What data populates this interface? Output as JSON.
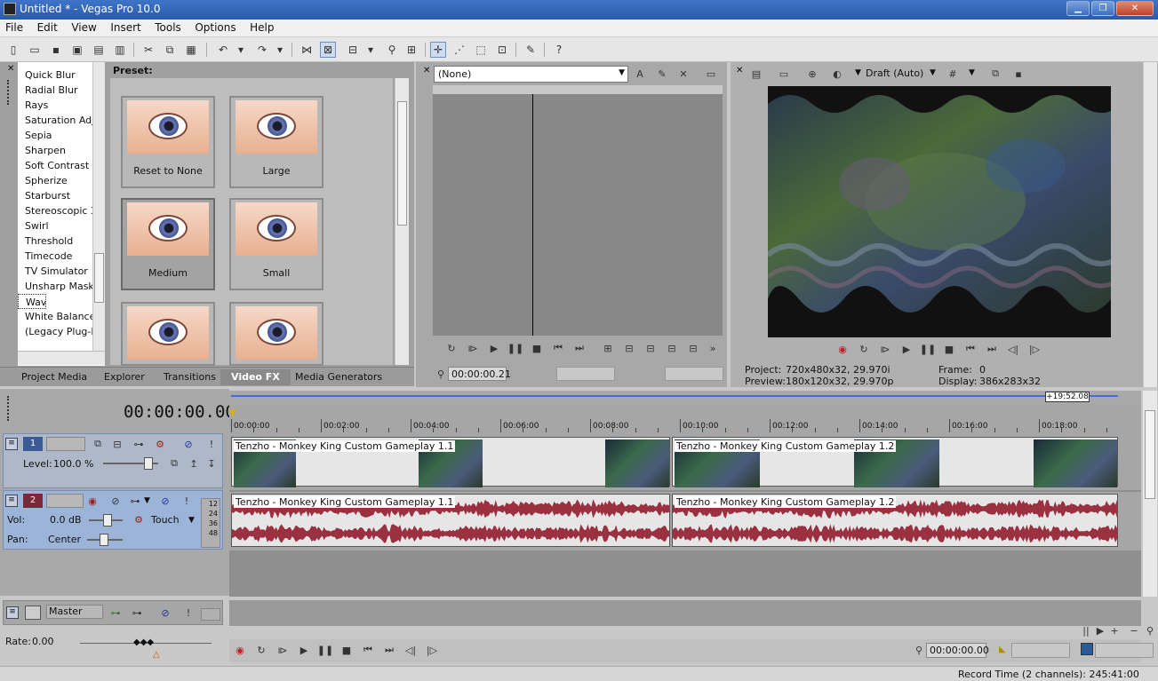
{
  "window": {
    "title": "Untitled * - Vegas Pro 10.0",
    "min": "▁",
    "max": "❐",
    "close": "✕"
  },
  "menu": [
    "File",
    "Edit",
    "View",
    "Insert",
    "Tools",
    "Options",
    "Help"
  ],
  "fx_list": [
    "Quick Blur",
    "Radial Blur",
    "Rays",
    "Saturation Adju",
    "Sepia",
    "Sharpen",
    "Soft Contrast",
    "Spherize",
    "Starburst",
    "Stereoscopic 3I",
    "Swirl",
    "Threshold",
    "Timecode",
    "TV Simulator",
    "Unsharp Mask",
    "Wave",
    "White Balance",
    "(Legacy Plug-I"
  ],
  "fx_selected": "Wave",
  "preset": {
    "label": "Preset:",
    "items": [
      "Reset to None",
      "Large",
      "Medium",
      "Small",
      "",
      ""
    ]
  },
  "tabs": [
    "Project Media",
    "Explorer",
    "Transitions",
    "Video FX",
    "Media Generators"
  ],
  "active_tab": "Video FX",
  "trimmer": {
    "dropdown": "(None)",
    "time": "00:00:00.21"
  },
  "preview": {
    "quality": "Draft (Auto)",
    "project_label": "Project:",
    "project_value": "720x480x32, 29.970i",
    "preview_label": "Preview:",
    "preview_value": "180x120x32, 29.970p",
    "frame_label": "Frame:",
    "frame_value": "0",
    "display_label": "Display:",
    "display_value": "386x283x32"
  },
  "timeline": {
    "time": "00:00:00.00",
    "end_marker": "+19:52.08",
    "ticks": [
      "00:00:00",
      "00:02:00",
      "00:04:00",
      "00:06:00",
      "00:08:00",
      "00:10:00",
      "00:12:00",
      "00:14:00",
      "00:16:00",
      "00:18:00"
    ],
    "video_track": {
      "number": "1",
      "level_label": "Level:",
      "level": "100.0 %"
    },
    "audio_track": {
      "number": "2",
      "vol_label": "Vol:",
      "vol": "0.0 dB",
      "pan_label": "Pan:",
      "pan": "Center",
      "mode": "Touch",
      "meter": [
        "12",
        "24",
        "36",
        "48"
      ]
    },
    "clip1": "Tenzho - Monkey King Custom Gameplay 1.1",
    "clip2": "Tenzho - Monkey King Custom Gameplay 1.2",
    "master": "Master"
  },
  "bottom": {
    "rate_label": "Rate:",
    "rate": "0.00",
    "time": "00:00:00.00",
    "status": "Record Time (2 channels): 245:41:00"
  },
  "colors": {
    "titlebar": "#2b5aa8",
    "panel": "#a9a9a9",
    "waveform": "#9a3040",
    "track_blue": "#9cb4d8"
  }
}
